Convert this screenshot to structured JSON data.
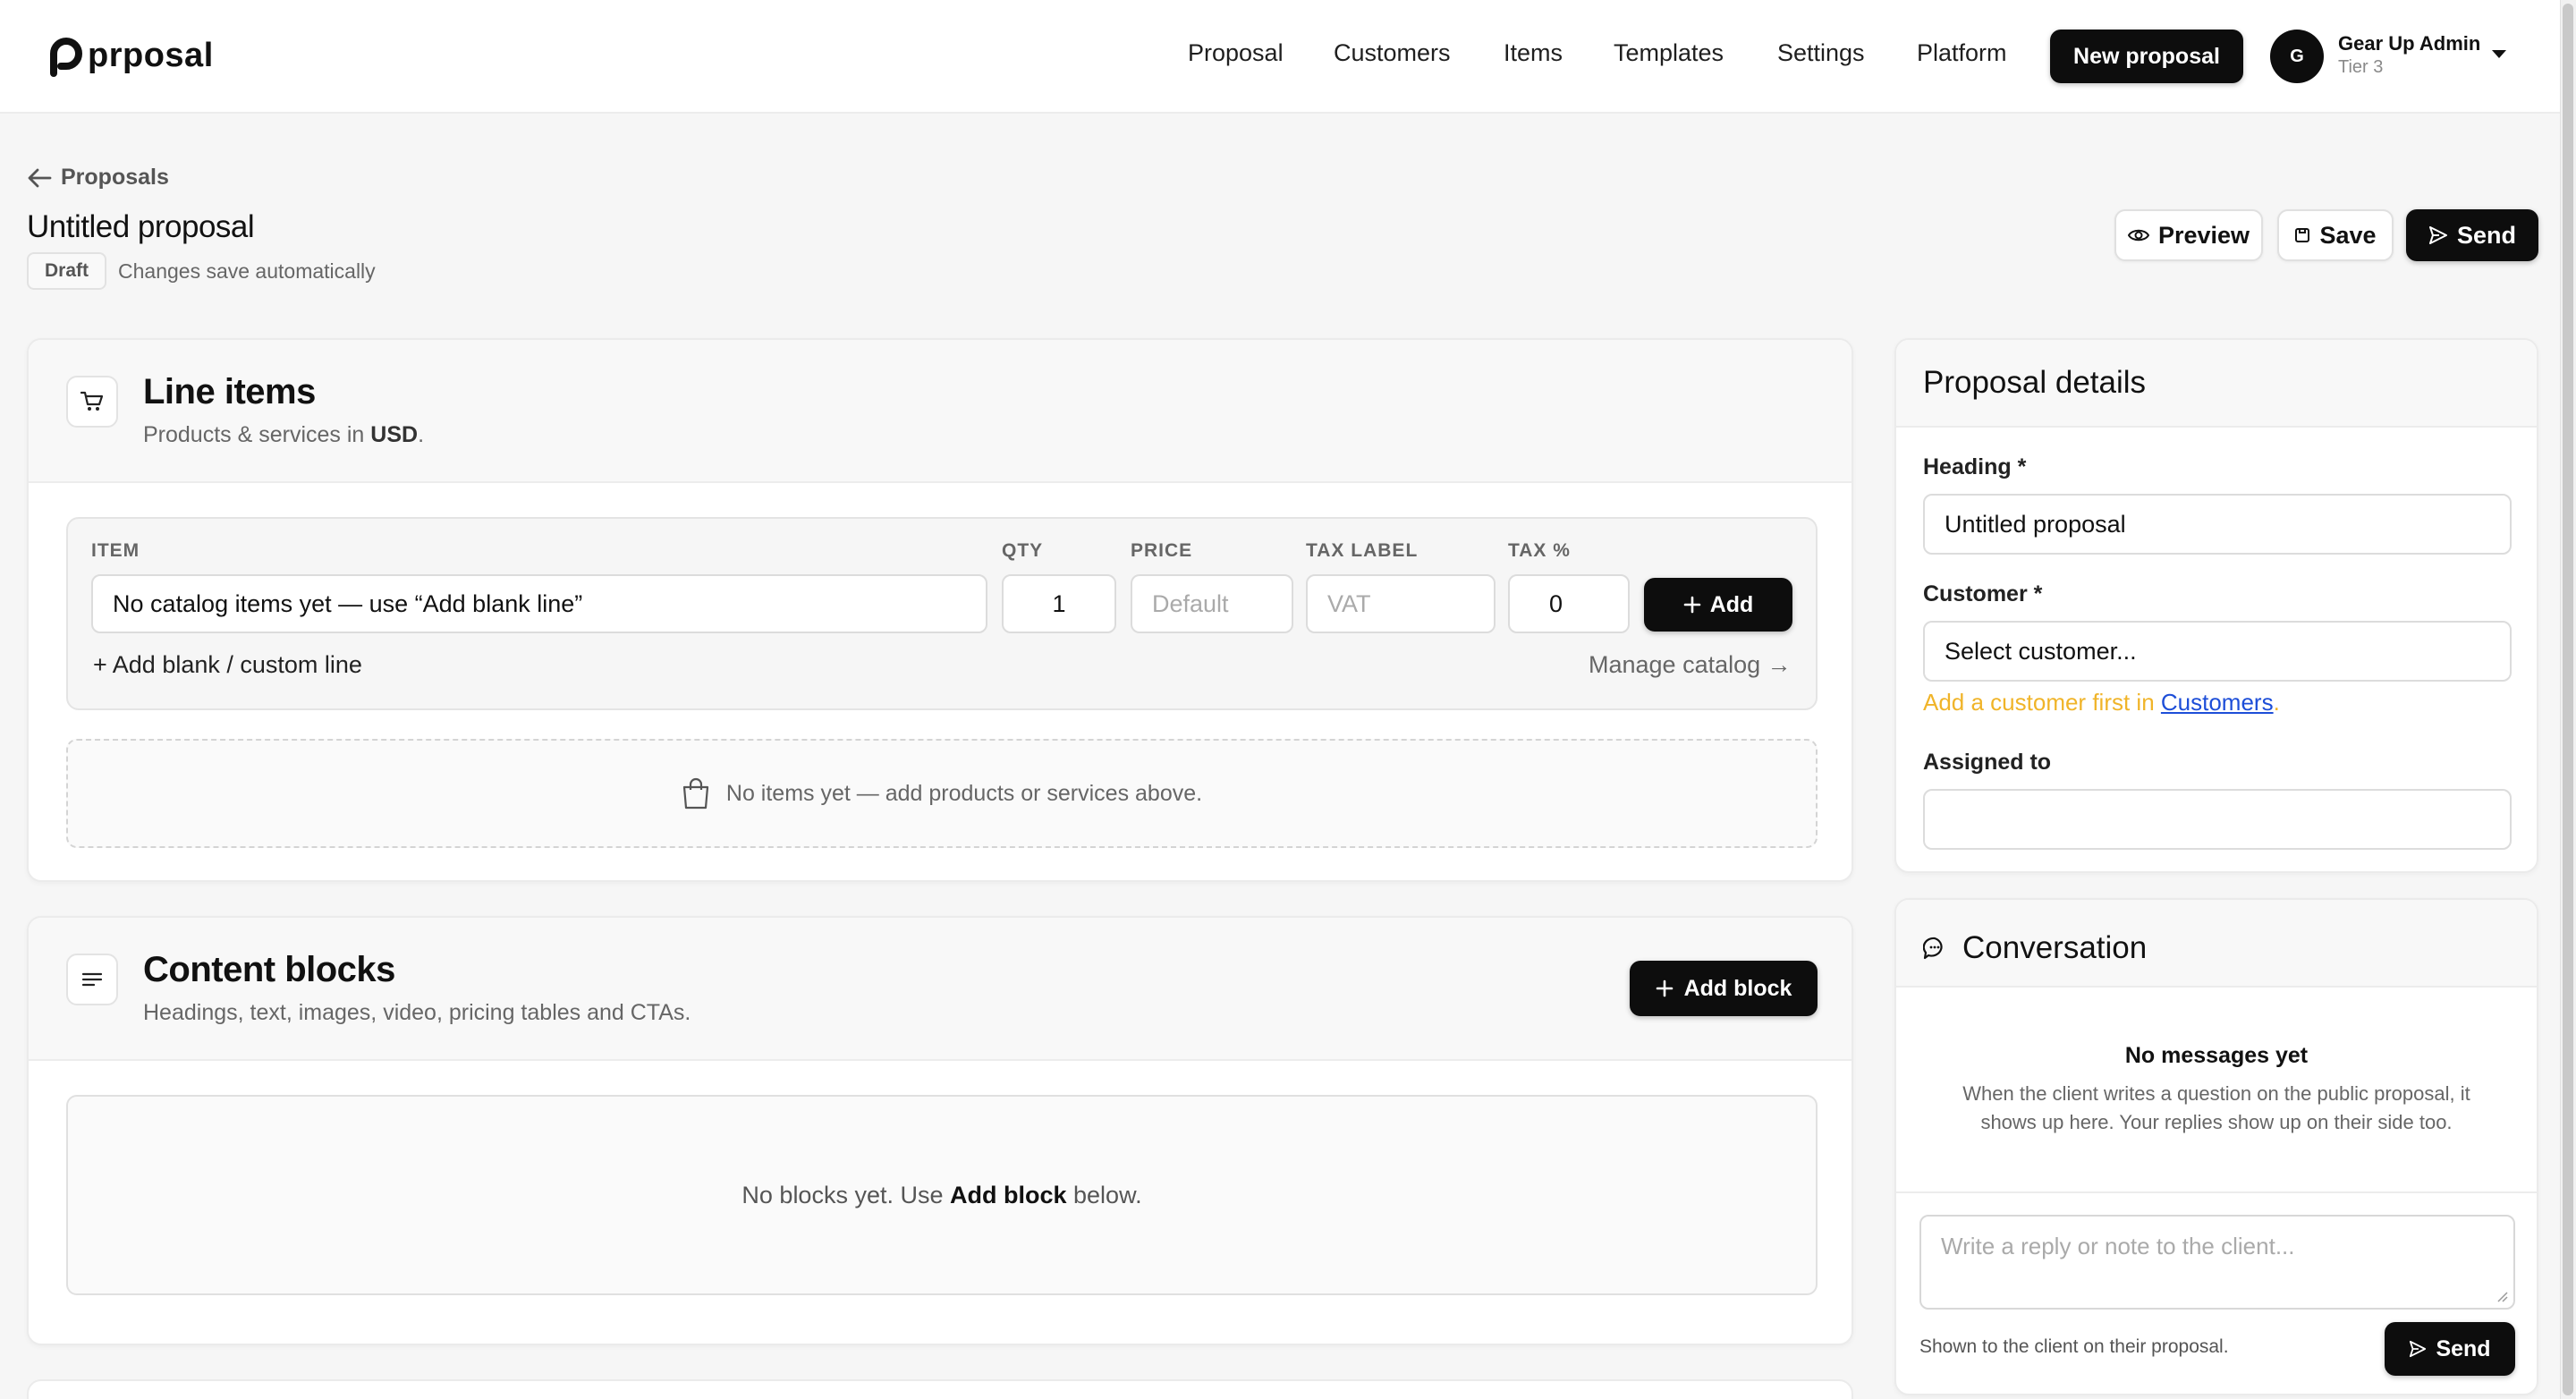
{
  "app": {
    "logo_text": "prposal"
  },
  "nav": {
    "links": [
      "Proposal",
      "Customers",
      "Items",
      "Templates",
      "Settings",
      "Platform"
    ],
    "new_proposal_label": "New proposal",
    "user": {
      "initial": "G",
      "name": "Gear Up Admin",
      "tier": "Tier 3"
    }
  },
  "header": {
    "back_label": "Proposals",
    "title": "Untitled proposal",
    "status_badge": "Draft",
    "autosave_note": "Changes save automatically",
    "preview_label": "Preview",
    "save_label": "Save",
    "send_label": "Send"
  },
  "line_items": {
    "title": "Line items",
    "subtitle_prefix": "Products & services in ",
    "currency": "USD",
    "subtitle_suffix": ".",
    "columns": {
      "item": "ITEM",
      "qty": "QTY",
      "price": "PRICE",
      "tax_label": "TAX LABEL",
      "tax_pct": "TAX %"
    },
    "item_value": "No catalog items yet — use “Add blank line”",
    "qty_value": "1",
    "price_placeholder": "Default",
    "tax_label_placeholder": "VAT",
    "tax_pct_value": "0",
    "add_label": "Add",
    "add_blank_label": "+ Add blank / custom line",
    "manage_catalog_label": "Manage catalog →",
    "empty_message": "No items yet — add products or services above."
  },
  "content_blocks": {
    "title": "Content blocks",
    "subtitle": "Headings, text, images, video, pricing tables and CTAs.",
    "add_block_label": "Add block",
    "empty_prefix": "No blocks yet. Use ",
    "empty_strong": "Add block",
    "empty_suffix": " below."
  },
  "proposal_details": {
    "title": "Proposal details",
    "heading_label": "Heading *",
    "heading_value": "Untitled proposal",
    "customer_label": "Customer *",
    "customer_value": "Select customer...",
    "customer_hint_prefix": "Add a customer first in ",
    "customer_hint_link": "Customers",
    "customer_hint_suffix": ".",
    "assigned_label": "Assigned to",
    "assigned_value": ""
  },
  "conversation": {
    "title": "Conversation",
    "empty_title": "No messages yet",
    "empty_line1": "When the client writes a question on the public proposal, it",
    "empty_line2": "shows up here. Your replies show up on their side too.",
    "reply_placeholder": "Write a reply or note to the client...",
    "footer_note": "Shown to the client on their proposal.",
    "send_label": "Send"
  },
  "colors": {
    "primary": "#0d0d0d",
    "warning_text": "#f0b429",
    "link": "#1d4ed8",
    "page_bg": "#f6f6f6"
  }
}
